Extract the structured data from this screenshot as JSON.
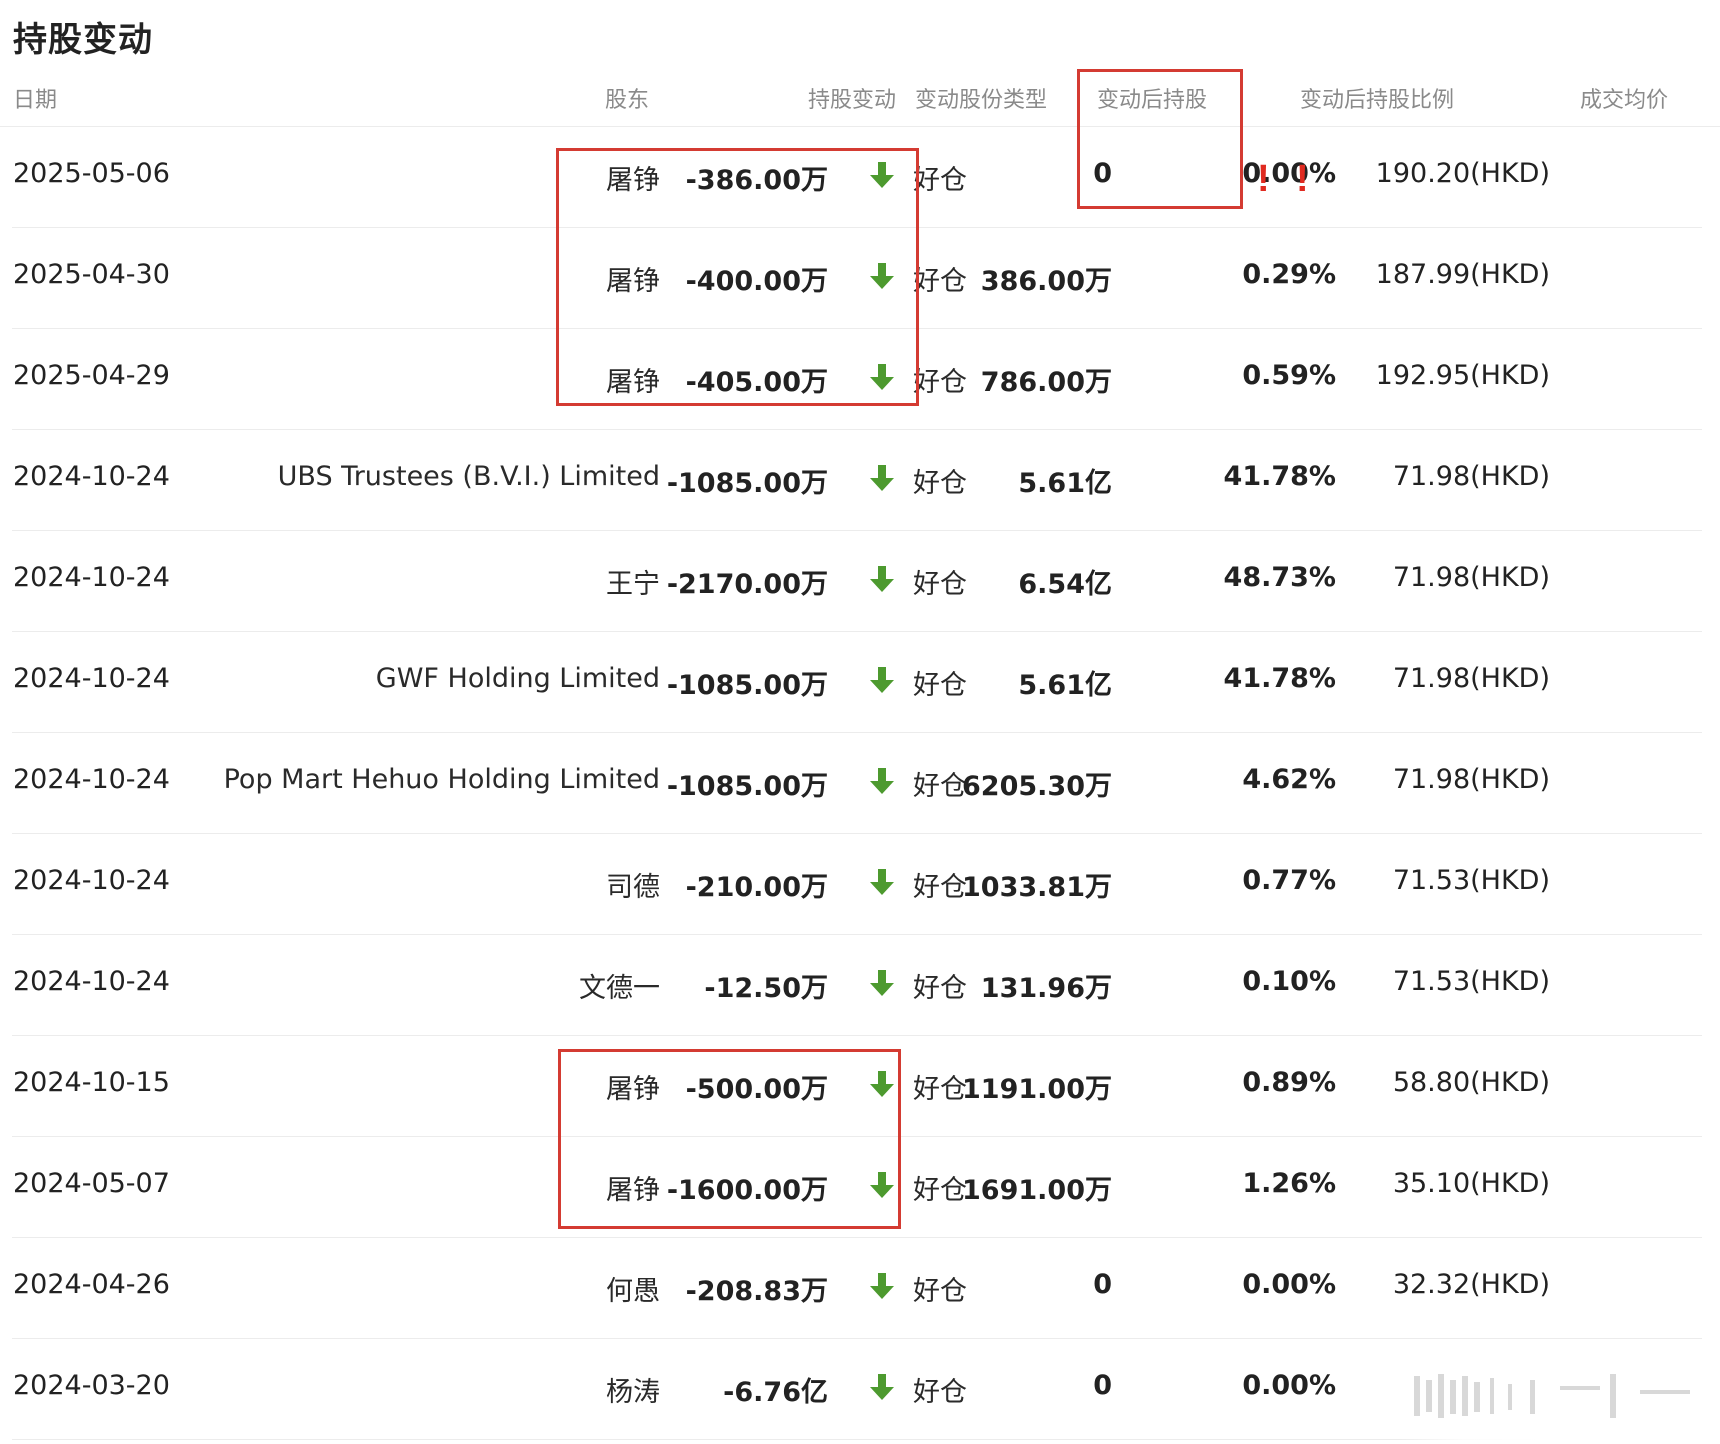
{
  "title": "持股变动",
  "headers": {
    "date": "日期",
    "holder": "股东",
    "change": "持股变动",
    "type": "变动股份类型",
    "after": "变动后持股",
    "ratio": "变动后持股比例",
    "price": "成交均价"
  },
  "annotation": {
    "exclamation": "!"
  },
  "colors": {
    "highlight_box": "#d43b32",
    "down_arrow": "#4d9a2f",
    "exclamation": "#e02a20"
  },
  "rows": [
    {
      "date": "2025-05-06",
      "holder": "屠铮",
      "change": "-386.00万",
      "type": "好仓",
      "after": "0",
      "ratio": "0.00%",
      "price": "190.20(HKD)"
    },
    {
      "date": "2025-04-30",
      "holder": "屠铮",
      "change": "-400.00万",
      "type": "好仓",
      "after": "386.00万",
      "ratio": "0.29%",
      "price": "187.99(HKD)"
    },
    {
      "date": "2025-04-29",
      "holder": "屠铮",
      "change": "-405.00万",
      "type": "好仓",
      "after": "786.00万",
      "ratio": "0.59%",
      "price": "192.95(HKD)"
    },
    {
      "date": "2024-10-24",
      "holder": "UBS Trustees (B.V.I.) Limited",
      "change": "-1085.00万",
      "type": "好仓",
      "after": "5.61亿",
      "ratio": "41.78%",
      "price": "71.98(HKD)"
    },
    {
      "date": "2024-10-24",
      "holder": "王宁",
      "change": "-2170.00万",
      "type": "好仓",
      "after": "6.54亿",
      "ratio": "48.73%",
      "price": "71.98(HKD)"
    },
    {
      "date": "2024-10-24",
      "holder": "GWF Holding Limited",
      "change": "-1085.00万",
      "type": "好仓",
      "after": "5.61亿",
      "ratio": "41.78%",
      "price": "71.98(HKD)"
    },
    {
      "date": "2024-10-24",
      "holder": "Pop Mart Hehuo Holding Limited",
      "change": "-1085.00万",
      "type": "好仓",
      "after": "6205.30万",
      "ratio": "4.62%",
      "price": "71.98(HKD)"
    },
    {
      "date": "2024-10-24",
      "holder": "司德",
      "change": "-210.00万",
      "type": "好仓",
      "after": "1033.81万",
      "ratio": "0.77%",
      "price": "71.53(HKD)"
    },
    {
      "date": "2024-10-24",
      "holder": "文德一",
      "change": "-12.50万",
      "type": "好仓",
      "after": "131.96万",
      "ratio": "0.10%",
      "price": "71.53(HKD)"
    },
    {
      "date": "2024-10-15",
      "holder": "屠铮",
      "change": "-500.00万",
      "type": "好仓",
      "after": "1191.00万",
      "ratio": "0.89%",
      "price": "58.80(HKD)"
    },
    {
      "date": "2024-05-07",
      "holder": "屠铮",
      "change": "-1600.00万",
      "type": "好仓",
      "after": "1691.00万",
      "ratio": "1.26%",
      "price": "35.10(HKD)"
    },
    {
      "date": "2024-04-26",
      "holder": "何愚",
      "change": "-208.83万",
      "type": "好仓",
      "after": "0",
      "ratio": "0.00%",
      "price": "32.32(HKD)"
    },
    {
      "date": "2024-03-20",
      "holder": "杨涛",
      "change": "-6.76亿",
      "type": "好仓",
      "after": "0",
      "ratio": "0.00%",
      "price": ""
    }
  ]
}
